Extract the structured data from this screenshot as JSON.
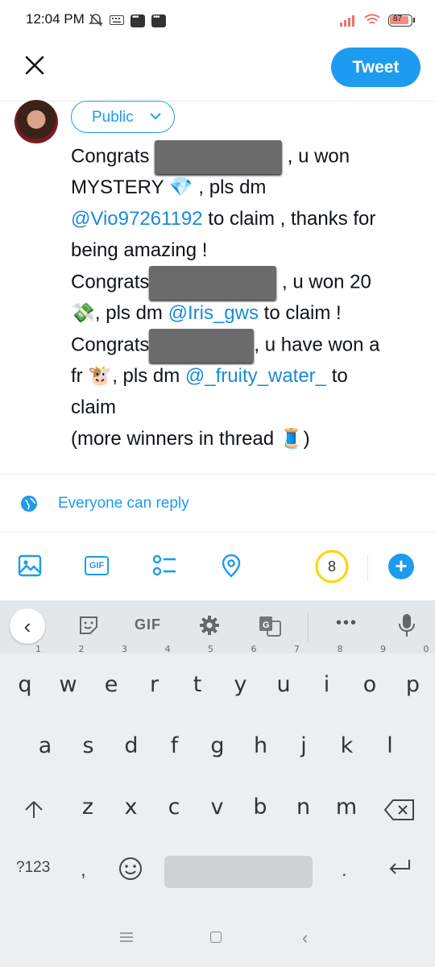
{
  "status_bar": {
    "time": "12:04 PM",
    "battery": "87"
  },
  "header": {
    "tweet_label": "Tweet"
  },
  "composer": {
    "audience": "Public",
    "lines": [
      {
        "parts": [
          {
            "t": "Congrats "
          },
          {
            "redact": 158
          },
          {
            "t": " , u won"
          }
        ]
      },
      {
        "parts": [
          {
            "t": "MYSTERY "
          },
          {
            "emoji": "💎"
          },
          {
            "t": " , pls dm"
          }
        ]
      },
      {
        "parts": [
          {
            "m": "@Vio97261192"
          },
          {
            "t": " to claim , thanks for"
          }
        ]
      },
      {
        "parts": [
          {
            "t": "being amazing !"
          }
        ]
      },
      {
        "parts": [
          {
            "t": "Congrats"
          },
          {
            "redact": 158
          },
          {
            "t": " , u won 20"
          }
        ]
      },
      {
        "parts": [
          {
            "emoji": "💸"
          },
          {
            "t": ", pls dm "
          },
          {
            "m": "@Iris_gws"
          },
          {
            "t": " to claim !"
          }
        ]
      },
      {
        "parts": [
          {
            "t": "Congrats"
          },
          {
            "redact": 130
          },
          {
            "t": ", u have won a"
          }
        ]
      },
      {
        "parts": [
          {
            "t": "fr "
          },
          {
            "emoji": "🐮"
          },
          {
            "t": ", pls dm "
          },
          {
            "m": "@_fruity_water_"
          },
          {
            "t": " to"
          }
        ]
      },
      {
        "parts": [
          {
            "t": "claim"
          }
        ]
      },
      {
        "parts": [
          {
            "t": "(more winners in thread "
          },
          {
            "emoji": "🧵"
          },
          {
            "t": ")"
          }
        ]
      }
    ]
  },
  "reply_setting": "Everyone can reply",
  "toolbar": {
    "char_remaining": "8",
    "gif_label": "GIF"
  },
  "keyboard": {
    "toolbar_gif": "GIF",
    "row1": [
      {
        "k": "q",
        "h": "1"
      },
      {
        "k": "w",
        "h": "2"
      },
      {
        "k": "e",
        "h": "3"
      },
      {
        "k": "r",
        "h": "4"
      },
      {
        "k": "t",
        "h": "5"
      },
      {
        "k": "y",
        "h": "6"
      },
      {
        "k": "u",
        "h": "7"
      },
      {
        "k": "i",
        "h": "8"
      },
      {
        "k": "o",
        "h": "9"
      },
      {
        "k": "p",
        "h": "0"
      }
    ],
    "row2": [
      "a",
      "s",
      "d",
      "f",
      "g",
      "h",
      "j",
      "k",
      "l"
    ],
    "row3": [
      "z",
      "x",
      "c",
      "v",
      "b",
      "n",
      "m"
    ],
    "symbols_label": "?123",
    "comma": ",",
    "period": "."
  },
  "colors": {
    "accent": "#1d9bf0",
    "mention": "#1b8ad8"
  }
}
